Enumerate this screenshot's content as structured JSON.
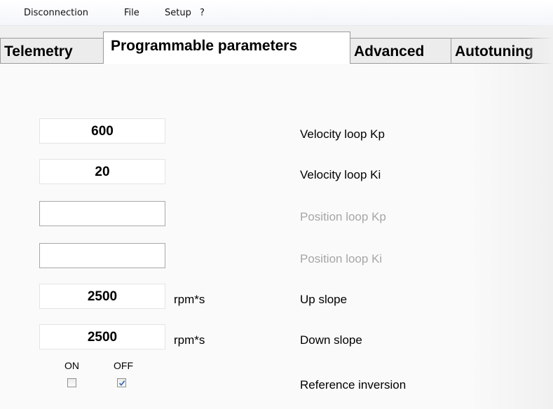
{
  "menu": {
    "items": [
      {
        "label": "Disconnection"
      },
      {
        "label": "File"
      },
      {
        "label": "Setup"
      },
      {
        "label": "?"
      }
    ]
  },
  "tabs": [
    {
      "label": "Telemetry",
      "active": false
    },
    {
      "label": "Programmable parameters",
      "active": true
    },
    {
      "label": "Advanced",
      "active": false
    },
    {
      "label": "Autotuning",
      "active": false
    }
  ],
  "parameters": [
    {
      "value": "600",
      "unit": "",
      "label": "Velocity loop Kp",
      "enabled": true
    },
    {
      "value": "20",
      "unit": "",
      "label": "Velocity loop Ki",
      "enabled": true
    },
    {
      "value": "",
      "unit": "",
      "label": "Position loop Kp",
      "enabled": false
    },
    {
      "value": "",
      "unit": "",
      "label": "Position loop Ki",
      "enabled": false
    },
    {
      "value": "2500",
      "unit": "rpm*s",
      "label": "Up slope",
      "enabled": true
    },
    {
      "value": "2500",
      "unit": "rpm*s",
      "label": "Down slope",
      "enabled": true
    }
  ],
  "reference_inversion": {
    "on_label": "ON",
    "off_label": "OFF",
    "on_checked": false,
    "off_checked": true,
    "label": "Reference inversion"
  },
  "colors": {
    "disabled_text": "#a6a6a6",
    "checkmark": "#3e6bb5"
  }
}
